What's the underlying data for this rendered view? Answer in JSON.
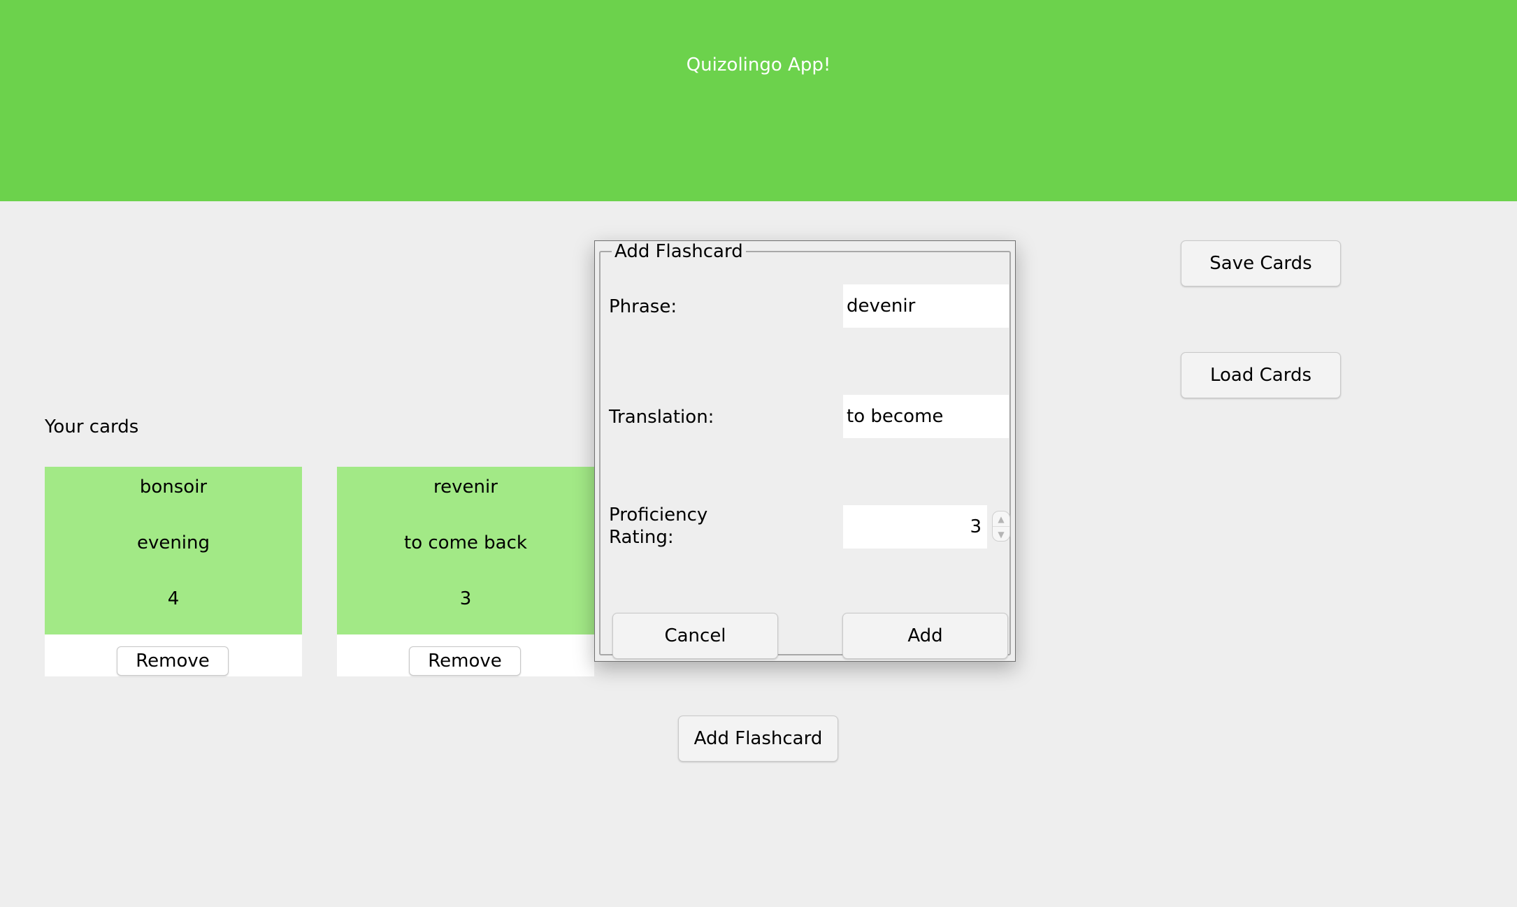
{
  "header": {
    "title": "Quizolingo App!"
  },
  "toolbar": {
    "save_label": "Save Cards",
    "load_label": "Load Cards"
  },
  "cards_section": {
    "heading": "Your cards",
    "remove_label": "Remove",
    "cards": [
      {
        "phrase": "bonsoir",
        "translation": "evening",
        "rating": "4"
      },
      {
        "phrase": "revenir",
        "translation": "to come back",
        "rating": "3"
      }
    ]
  },
  "add_button_label": "Add Flashcard",
  "dialog": {
    "title": "Add Flashcard",
    "phrase_label": "Phrase:",
    "phrase_value": "devenir",
    "translation_label": "Translation:",
    "translation_value": "to become",
    "rating_label_line1": "Proficiency",
    "rating_label_line2": "Rating:",
    "rating_value": "3",
    "cancel_label": "Cancel",
    "add_label": "Add"
  },
  "icons": {
    "spinner_up": "chevron-up-icon",
    "spinner_down": "chevron-down-icon"
  },
  "colors": {
    "header": "#6cd24c",
    "card": "#a2e986",
    "background": "#eeeeee"
  }
}
